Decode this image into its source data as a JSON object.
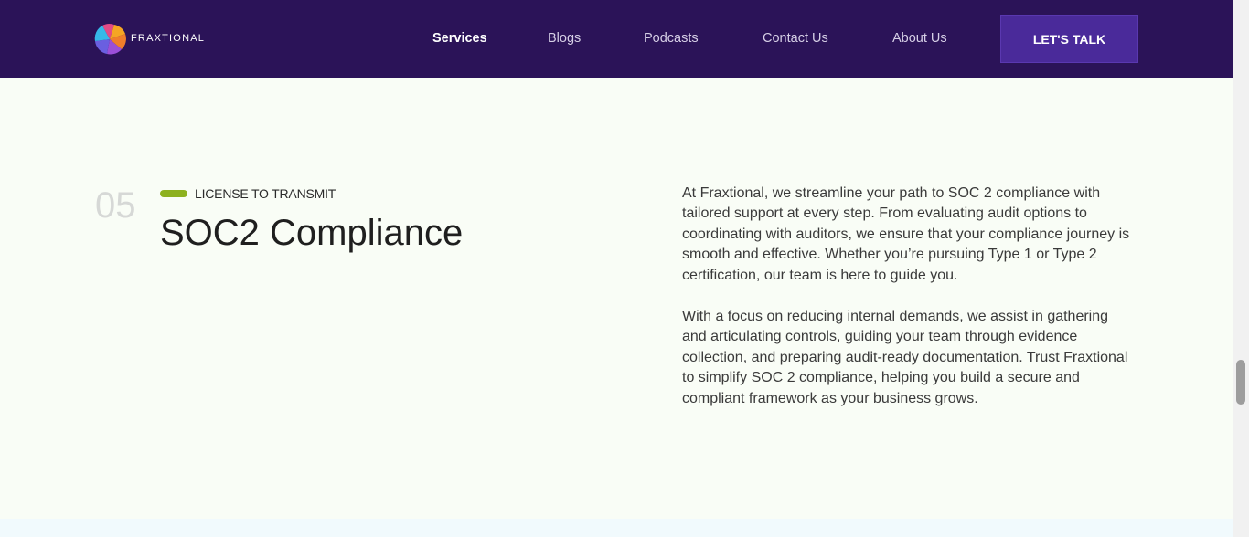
{
  "brand": {
    "name": "FRAXTIONAL",
    "logo_icon": "pinwheel-logo-icon"
  },
  "nav": {
    "items": [
      {
        "label": "Services",
        "active": true
      },
      {
        "label": "Blogs",
        "active": false
      },
      {
        "label": "Podcasts",
        "active": false
      },
      {
        "label": "Contact Us",
        "active": false
      },
      {
        "label": "About Us",
        "active": false
      }
    ],
    "cta_label": "LET'S TALK"
  },
  "section": {
    "number": "05",
    "eyebrow": "LICENSE TO TRANSMIT",
    "title": "SOC2 Compliance",
    "paragraphs": [
      "At Fraxtional, we streamline your path to SOC 2 compliance with tailored support at every step. From evaluating audit options to coordinating with auditors, we ensure that your compliance journey is smooth and effective. Whether you’re pursuing Type 1 or Type 2 certification, our team is here to guide you.",
      "With a focus on reducing internal demands, we assist in gathering and articulating controls, guiding your team through evidence collection, and preparing audit-ready documentation. Trust Fraxtional to simplify SOC 2 compliance, helping you build a secure and compliant framework as your business grows."
    ]
  },
  "colors": {
    "header_bg": "#2b1358",
    "cta_bg": "#4a2a9a",
    "accent_green": "#8db11f",
    "page_bg": "#f9fdf6"
  }
}
